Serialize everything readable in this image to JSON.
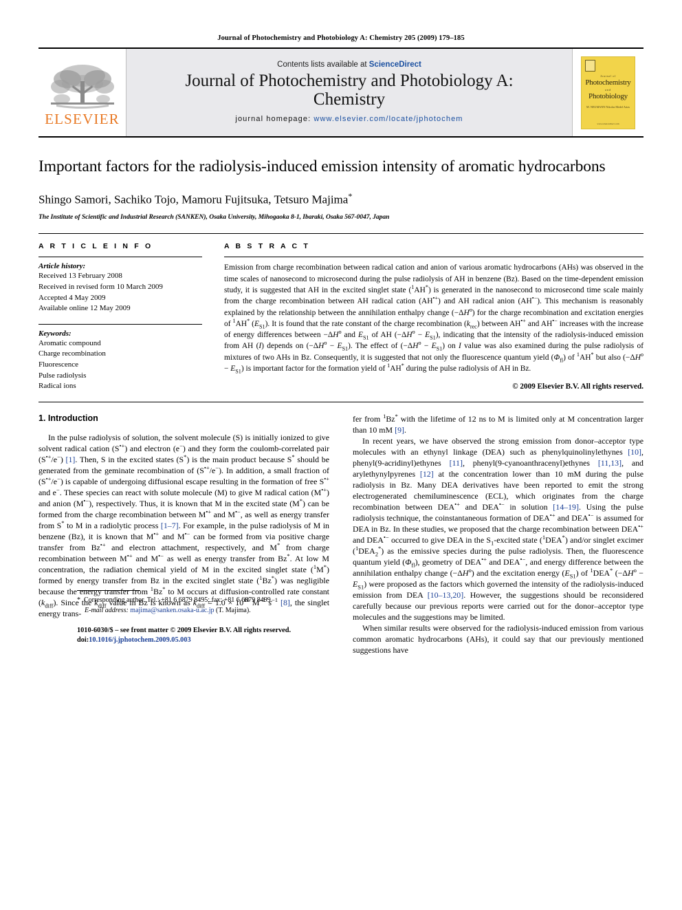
{
  "running_head": "Journal of Photochemistry and Photobiology A: Chemistry 205 (2009) 179–185",
  "masthead": {
    "contents_prefix": "Contents lists available at ",
    "sciencedirect": "ScienceDirect",
    "journal_title_line1": "Journal of Photochemistry and Photobiology A:",
    "journal_title_line2": "Chemistry",
    "homepage_prefix": "journal homepage: ",
    "homepage_url": "www.elsevier.com/locate/jphotochem",
    "publisher_wordmark": "ELSEVIER",
    "cover": {
      "subtitle": "Journal of",
      "title_line1": "Photochemistry",
      "and": "and",
      "title_line2": "Photobiology",
      "editors": "M. NEUMANN\nNikolas Medel Arias",
      "url": "www.sciencedirect.com"
    }
  },
  "article": {
    "title": "Important factors for the radiolysis-induced emission intensity of aromatic hydrocarbons",
    "authors": "Shingo Samori, Sachiko Tojo, Mamoru Fujitsuka, Tetsuro Majima",
    "corresponding_marker": "*",
    "affiliation": "The Institute of Scientific and Industrial Research (SANKEN), Osaka University, Mihogaoka 8-1, Ibaraki, Osaka 567-0047, Japan"
  },
  "article_info": {
    "label": "A R T I C L E     I N F O",
    "history_label": "Article history:",
    "history": [
      "Received 13 February 2008",
      "Received in revised form 10 March 2009",
      "Accepted 4 May 2009",
      "Available online 12 May 2009"
    ],
    "keywords_label": "Keywords:",
    "keywords": [
      "Aromatic compound",
      "Charge recombination",
      "Fluorescence",
      "Pulse radiolysis",
      "Radical ions"
    ]
  },
  "abstract": {
    "label": "A B S T R A C T",
    "copyright": "© 2009 Elsevier B.V. All rights reserved."
  },
  "introduction": {
    "heading": "1.  Introduction"
  },
  "footnotes": {
    "corresponding": "Corresponding author. Tel.: +81 6 6879 8495; fax: +81 6 6879 8499.",
    "email_label": "E-mail address:",
    "email": "majima@sanken.osaka-u.ac.jp",
    "email_suffix": "(T. Majima)."
  },
  "issn": {
    "line1": "1010-6030/$ – see front matter © 2009 Elsevier B.V. All rights reserved.",
    "doi_label": "doi:",
    "doi": "10.1016/j.jphotochem.2009.05.003"
  },
  "colors": {
    "link": "#1a3f96",
    "sciencedirect": "#1a4fa0",
    "elsevier_orange": "#E87722",
    "masthead_bg": "#e9e9ec",
    "cover_yellow": "#f2d44a"
  }
}
